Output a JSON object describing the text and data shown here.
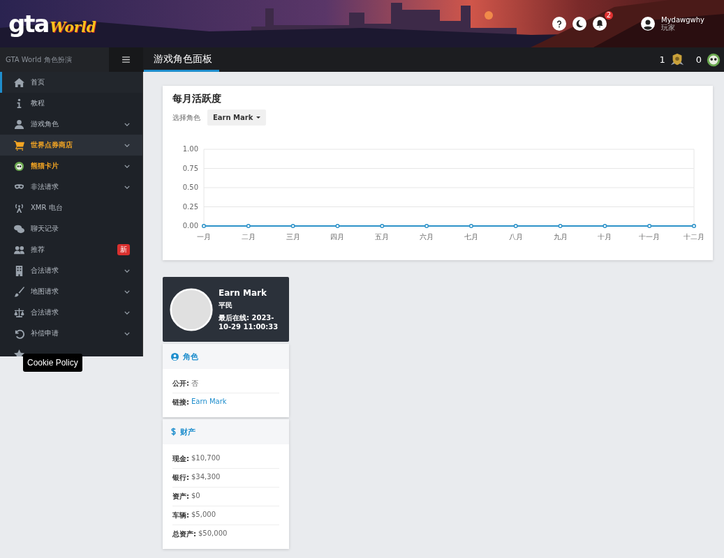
{
  "header": {
    "logo": {
      "part_1": "gta",
      "part_2": "World"
    },
    "notifications_badge": "2",
    "user": {
      "name": "Mydawgwhy",
      "role": "玩家"
    }
  },
  "navbar": {
    "brand": "GTA World 角色扮演",
    "title": "游戏角色面板",
    "counters": [
      {
        "value": "1",
        "kind": "medal"
      },
      {
        "value": "0",
        "kind": "panda"
      }
    ]
  },
  "sidebar": {
    "items": [
      {
        "label": "首页",
        "kind": "home",
        "selected": true,
        "highlighted": false,
        "featured": false,
        "has_submenu": false
      },
      {
        "label": "教程",
        "kind": "info",
        "selected": false,
        "highlighted": false,
        "featured": false,
        "has_submenu": false
      },
      {
        "label": "游戏角色",
        "kind": "user",
        "selected": false,
        "highlighted": false,
        "featured": false,
        "has_submenu": true
      },
      {
        "label": "世界点券商店",
        "kind": "cart",
        "selected": false,
        "highlighted": true,
        "featured": true,
        "has_submenu": true
      },
      {
        "label": "熊猫卡片",
        "kind": "panda",
        "selected": false,
        "highlighted": false,
        "featured": true,
        "has_submenu": true
      },
      {
        "label": "非法请求",
        "kind": "mask",
        "selected": false,
        "highlighted": false,
        "featured": false,
        "has_submenu": true
      },
      {
        "label": "XMR 电台",
        "kind": "radio",
        "selected": false,
        "highlighted": false,
        "featured": false,
        "has_submenu": false
      },
      {
        "label": "聊天记录",
        "kind": "chat",
        "selected": false,
        "highlighted": false,
        "featured": false,
        "has_submenu": false
      },
      {
        "label": "推荐",
        "kind": "users",
        "badge": "新",
        "selected": false,
        "highlighted": false,
        "featured": false,
        "has_submenu": false
      },
      {
        "label": "合法请求",
        "kind": "building",
        "selected": false,
        "highlighted": false,
        "featured": false,
        "has_submenu": true
      },
      {
        "label": "地图请求",
        "kind": "brush",
        "selected": false,
        "highlighted": false,
        "featured": false,
        "has_submenu": true
      },
      {
        "label": "合法请求",
        "kind": "scale",
        "selected": false,
        "highlighted": false,
        "featured": false,
        "has_submenu": true
      },
      {
        "label": "补偿申请",
        "kind": "undo",
        "selected": false,
        "highlighted": false,
        "featured": false,
        "has_submenu": true
      },
      {
        "kind": "star",
        "selected": false
      }
    ]
  },
  "cookie_tooltip": "Cookie Policy",
  "activity_card": {
    "title": "每月活跃度",
    "select_label": "选择角色",
    "select_value": "Earn Mark",
    "chart_data": {
      "type": "line",
      "categories": [
        "一月",
        "二月",
        "三月",
        "四月",
        "五月",
        "六月",
        "七月",
        "八月",
        "九月",
        "十月",
        "十一月",
        "十二月"
      ],
      "series": [
        {
          "color": "#2e93c9",
          "marker": true,
          "values": [
            0,
            0,
            0,
            0,
            0,
            0,
            0,
            0,
            0,
            0,
            0,
            0
          ]
        }
      ],
      "grid": true,
      "ylim": [
        0,
        1
      ],
      "yticks": [
        {
          "value": 0,
          "label": "0.00"
        },
        {
          "value": 0.25,
          "label": "0.25"
        },
        {
          "value": 0.5,
          "label": "0.50"
        },
        {
          "value": 0.75,
          "label": "0.75"
        },
        {
          "value": 1,
          "label": "1.00"
        }
      ]
    }
  },
  "profile": {
    "name": "Earn Mark",
    "rank": "平民",
    "last_online": "最后在线: 2023-10-29 11:00:33"
  },
  "character_card": {
    "title": "角色",
    "rows": [
      {
        "label": "公开:",
        "value": "否",
        "kind": "text"
      },
      {
        "label": "链接:",
        "value": "Earn Mark",
        "kind": "link"
      }
    ]
  },
  "assets_card": {
    "title": "财产",
    "rows": [
      {
        "label": "现金:",
        "value": "$10,700"
      },
      {
        "label": "银行:",
        "value": "$34,300"
      },
      {
        "label": "资产:",
        "value": "$0"
      },
      {
        "label": "车辆:",
        "value": "$5,000"
      },
      {
        "label": "总资产:",
        "value": "$50,000"
      }
    ]
  }
}
